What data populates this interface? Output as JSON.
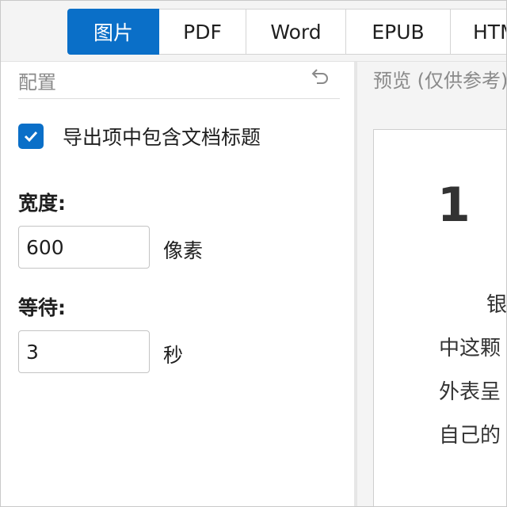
{
  "tabs": [
    {
      "label": "图片",
      "active": true
    },
    {
      "label": "PDF",
      "active": false
    },
    {
      "label": "Word",
      "active": false
    },
    {
      "label": "EPUB",
      "active": false
    },
    {
      "label": "HTML",
      "active": false
    }
  ],
  "config": {
    "title": "配置",
    "reset_icon": "undo-icon",
    "include_title": {
      "label": "导出项中包含文档标题",
      "checked": true
    },
    "width": {
      "label": "宽度:",
      "value": "600",
      "unit": "像素"
    },
    "wait": {
      "label": "等待:",
      "value": "3",
      "unit": "秒"
    }
  },
  "preview": {
    "title": "预览 (仅供参考)",
    "heading": "1",
    "lines": [
      "银",
      "中这颗",
      "外表呈",
      "自己的"
    ]
  },
  "colors": {
    "accent": "#0a6fc8"
  }
}
